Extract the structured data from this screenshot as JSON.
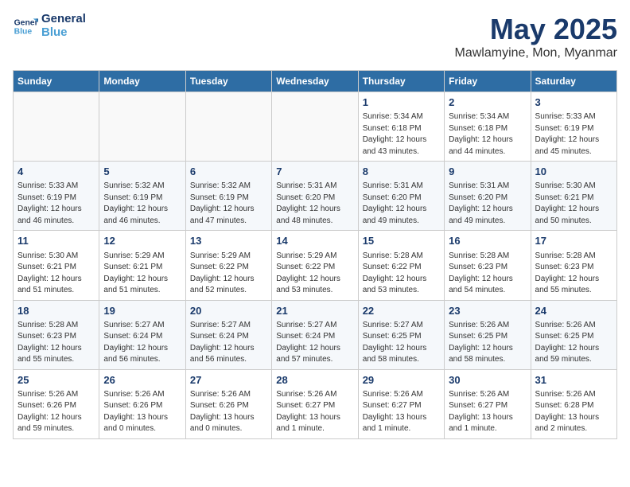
{
  "logo": {
    "line1": "General",
    "line2": "Blue"
  },
  "title": "May 2025",
  "subtitle": "Mawlamyine, Mon, Myanmar",
  "headers": [
    "Sunday",
    "Monday",
    "Tuesday",
    "Wednesday",
    "Thursday",
    "Friday",
    "Saturday"
  ],
  "weeks": [
    [
      {
        "day": "",
        "info": ""
      },
      {
        "day": "",
        "info": ""
      },
      {
        "day": "",
        "info": ""
      },
      {
        "day": "",
        "info": ""
      },
      {
        "day": "1",
        "info": "Sunrise: 5:34 AM\nSunset: 6:18 PM\nDaylight: 12 hours\nand 43 minutes."
      },
      {
        "day": "2",
        "info": "Sunrise: 5:34 AM\nSunset: 6:18 PM\nDaylight: 12 hours\nand 44 minutes."
      },
      {
        "day": "3",
        "info": "Sunrise: 5:33 AM\nSunset: 6:19 PM\nDaylight: 12 hours\nand 45 minutes."
      }
    ],
    [
      {
        "day": "4",
        "info": "Sunrise: 5:33 AM\nSunset: 6:19 PM\nDaylight: 12 hours\nand 46 minutes."
      },
      {
        "day": "5",
        "info": "Sunrise: 5:32 AM\nSunset: 6:19 PM\nDaylight: 12 hours\nand 46 minutes."
      },
      {
        "day": "6",
        "info": "Sunrise: 5:32 AM\nSunset: 6:19 PM\nDaylight: 12 hours\nand 47 minutes."
      },
      {
        "day": "7",
        "info": "Sunrise: 5:31 AM\nSunset: 6:20 PM\nDaylight: 12 hours\nand 48 minutes."
      },
      {
        "day": "8",
        "info": "Sunrise: 5:31 AM\nSunset: 6:20 PM\nDaylight: 12 hours\nand 49 minutes."
      },
      {
        "day": "9",
        "info": "Sunrise: 5:31 AM\nSunset: 6:20 PM\nDaylight: 12 hours\nand 49 minutes."
      },
      {
        "day": "10",
        "info": "Sunrise: 5:30 AM\nSunset: 6:21 PM\nDaylight: 12 hours\nand 50 minutes."
      }
    ],
    [
      {
        "day": "11",
        "info": "Sunrise: 5:30 AM\nSunset: 6:21 PM\nDaylight: 12 hours\nand 51 minutes."
      },
      {
        "day": "12",
        "info": "Sunrise: 5:29 AM\nSunset: 6:21 PM\nDaylight: 12 hours\nand 51 minutes."
      },
      {
        "day": "13",
        "info": "Sunrise: 5:29 AM\nSunset: 6:22 PM\nDaylight: 12 hours\nand 52 minutes."
      },
      {
        "day": "14",
        "info": "Sunrise: 5:29 AM\nSunset: 6:22 PM\nDaylight: 12 hours\nand 53 minutes."
      },
      {
        "day": "15",
        "info": "Sunrise: 5:28 AM\nSunset: 6:22 PM\nDaylight: 12 hours\nand 53 minutes."
      },
      {
        "day": "16",
        "info": "Sunrise: 5:28 AM\nSunset: 6:23 PM\nDaylight: 12 hours\nand 54 minutes."
      },
      {
        "day": "17",
        "info": "Sunrise: 5:28 AM\nSunset: 6:23 PM\nDaylight: 12 hours\nand 55 minutes."
      }
    ],
    [
      {
        "day": "18",
        "info": "Sunrise: 5:28 AM\nSunset: 6:23 PM\nDaylight: 12 hours\nand 55 minutes."
      },
      {
        "day": "19",
        "info": "Sunrise: 5:27 AM\nSunset: 6:24 PM\nDaylight: 12 hours\nand 56 minutes."
      },
      {
        "day": "20",
        "info": "Sunrise: 5:27 AM\nSunset: 6:24 PM\nDaylight: 12 hours\nand 56 minutes."
      },
      {
        "day": "21",
        "info": "Sunrise: 5:27 AM\nSunset: 6:24 PM\nDaylight: 12 hours\nand 57 minutes."
      },
      {
        "day": "22",
        "info": "Sunrise: 5:27 AM\nSunset: 6:25 PM\nDaylight: 12 hours\nand 58 minutes."
      },
      {
        "day": "23",
        "info": "Sunrise: 5:26 AM\nSunset: 6:25 PM\nDaylight: 12 hours\nand 58 minutes."
      },
      {
        "day": "24",
        "info": "Sunrise: 5:26 AM\nSunset: 6:25 PM\nDaylight: 12 hours\nand 59 minutes."
      }
    ],
    [
      {
        "day": "25",
        "info": "Sunrise: 5:26 AM\nSunset: 6:26 PM\nDaylight: 12 hours\nand 59 minutes."
      },
      {
        "day": "26",
        "info": "Sunrise: 5:26 AM\nSunset: 6:26 PM\nDaylight: 13 hours\nand 0 minutes."
      },
      {
        "day": "27",
        "info": "Sunrise: 5:26 AM\nSunset: 6:26 PM\nDaylight: 13 hours\nand 0 minutes."
      },
      {
        "day": "28",
        "info": "Sunrise: 5:26 AM\nSunset: 6:27 PM\nDaylight: 13 hours\nand 1 minute."
      },
      {
        "day": "29",
        "info": "Sunrise: 5:26 AM\nSunset: 6:27 PM\nDaylight: 13 hours\nand 1 minute."
      },
      {
        "day": "30",
        "info": "Sunrise: 5:26 AM\nSunset: 6:27 PM\nDaylight: 13 hours\nand 1 minute."
      },
      {
        "day": "31",
        "info": "Sunrise: 5:26 AM\nSunset: 6:28 PM\nDaylight: 13 hours\nand 2 minutes."
      }
    ]
  ]
}
